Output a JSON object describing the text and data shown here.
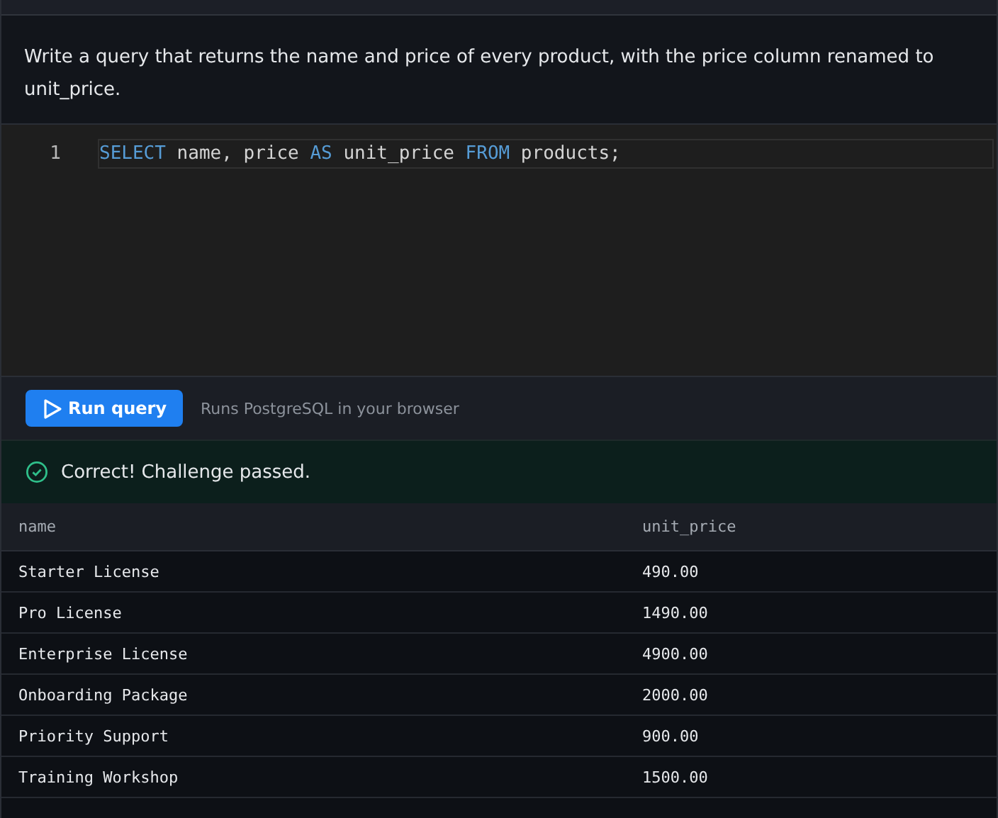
{
  "prompt": "Write a query that returns the name and price of every product, with the price column renamed to unit_price.",
  "editor": {
    "lines": [
      {
        "number": "1",
        "tokens": [
          {
            "text": "SELECT",
            "kind": "keyword"
          },
          {
            "text": " name, price ",
            "kind": "plain"
          },
          {
            "text": "AS",
            "kind": "keyword"
          },
          {
            "text": " unit_price ",
            "kind": "plain"
          },
          {
            "text": "FROM",
            "kind": "keyword"
          },
          {
            "text": " products;",
            "kind": "plain"
          }
        ],
        "active": true
      }
    ]
  },
  "toolbar": {
    "run_button": "Run query",
    "hint": "Runs PostgreSQL in your browser"
  },
  "result": {
    "passed": true,
    "message": "Correct! Challenge passed."
  },
  "table": {
    "columns": [
      "name",
      "unit_price"
    ],
    "rows": [
      [
        "Starter License",
        "490.00"
      ],
      [
        "Pro License",
        "1490.00"
      ],
      [
        "Enterprise License",
        "4900.00"
      ],
      [
        "Onboarding Package",
        "2000.00"
      ],
      [
        "Priority Support",
        "900.00"
      ],
      [
        "Training Workshop",
        "1500.00"
      ]
    ]
  }
}
